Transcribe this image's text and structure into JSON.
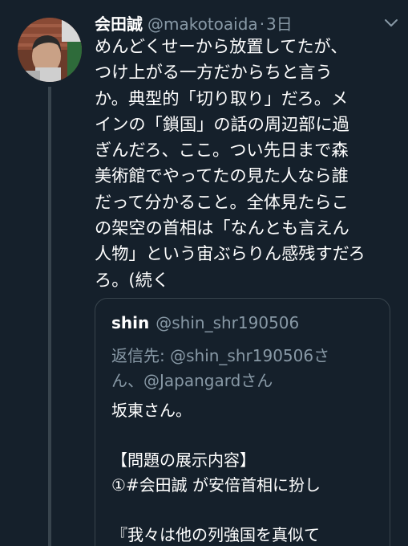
{
  "tweet": {
    "author_name": "会田誠",
    "author_handle": "@makotoaida",
    "separator": "·",
    "time": "3日",
    "text_lines": [
      "めんどくせーから放置してたが、",
      "つけ上がる一方だからちと言う",
      "か。典型的「切り取り」だろ。メ",
      "インの「鎖国」の話の周辺部に過",
      "ぎんだろ、ここ。つい先日まで森",
      "美術館でやってたの見た人なら誰",
      "だって分かること。全体見たらこ",
      "の架空の首相は「なんとも言えん",
      "人物」という宙ぶらりん感残すだろ",
      "ろ。(続く"
    ]
  },
  "quote": {
    "author_name": "shin",
    "author_handle": "@shin_shr190506",
    "reply_to_lines": [
      "返信先: @shin_shr190506さ",
      "ん、@Japangardさん"
    ],
    "body_lines": [
      "坂東さん。",
      "",
      "【問題の展示内容】",
      "①#会田誠 が安倍首相に扮し",
      "",
      "『我々は他の列強国を真似て"
    ]
  },
  "icons": {
    "menu": "chevron-down-icon",
    "avatar": "avatar"
  },
  "colors": {
    "background": "#15202b",
    "secondary_text": "#8899a6",
    "border": "#38444d"
  }
}
